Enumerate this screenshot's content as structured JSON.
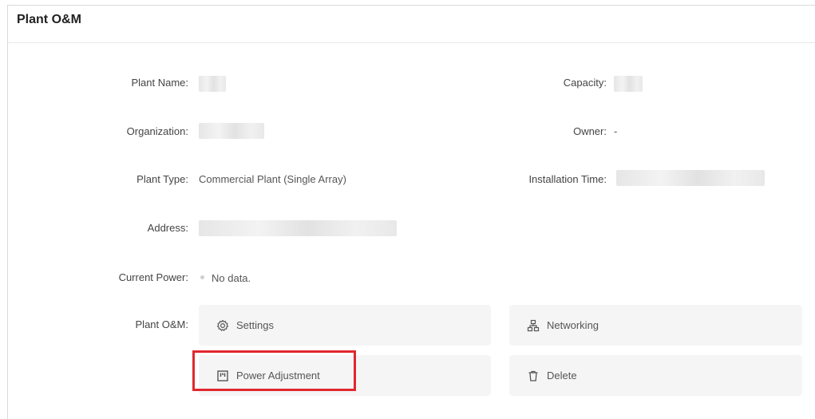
{
  "header": {
    "title": "Plant O&M"
  },
  "fields": {
    "plant_name_label": "Plant Name",
    "capacity_label": "Capacity",
    "organization_label": "Organization",
    "owner_label": "Owner",
    "owner_value": "-",
    "plant_type_label": "Plant Type",
    "plant_type_value": "Commercial Plant (Single Array)",
    "installation_time_label": "Installation Time",
    "address_label": "Address",
    "current_power_label": "Current Power",
    "current_power_value": "No data.",
    "plant_om_label": "Plant O&M"
  },
  "om_actions": {
    "settings": {
      "label": "Settings",
      "icon": "gear-icon"
    },
    "networking": {
      "label": "Networking",
      "icon": "network-icon"
    },
    "power_adjustment": {
      "label": "Power Adjustment",
      "icon": "power-adjust-icon"
    },
    "delete": {
      "label": "Delete",
      "icon": "trash-icon"
    }
  },
  "colors": {
    "highlight": "#e0282e",
    "button_bg": "#f5f5f5"
  }
}
